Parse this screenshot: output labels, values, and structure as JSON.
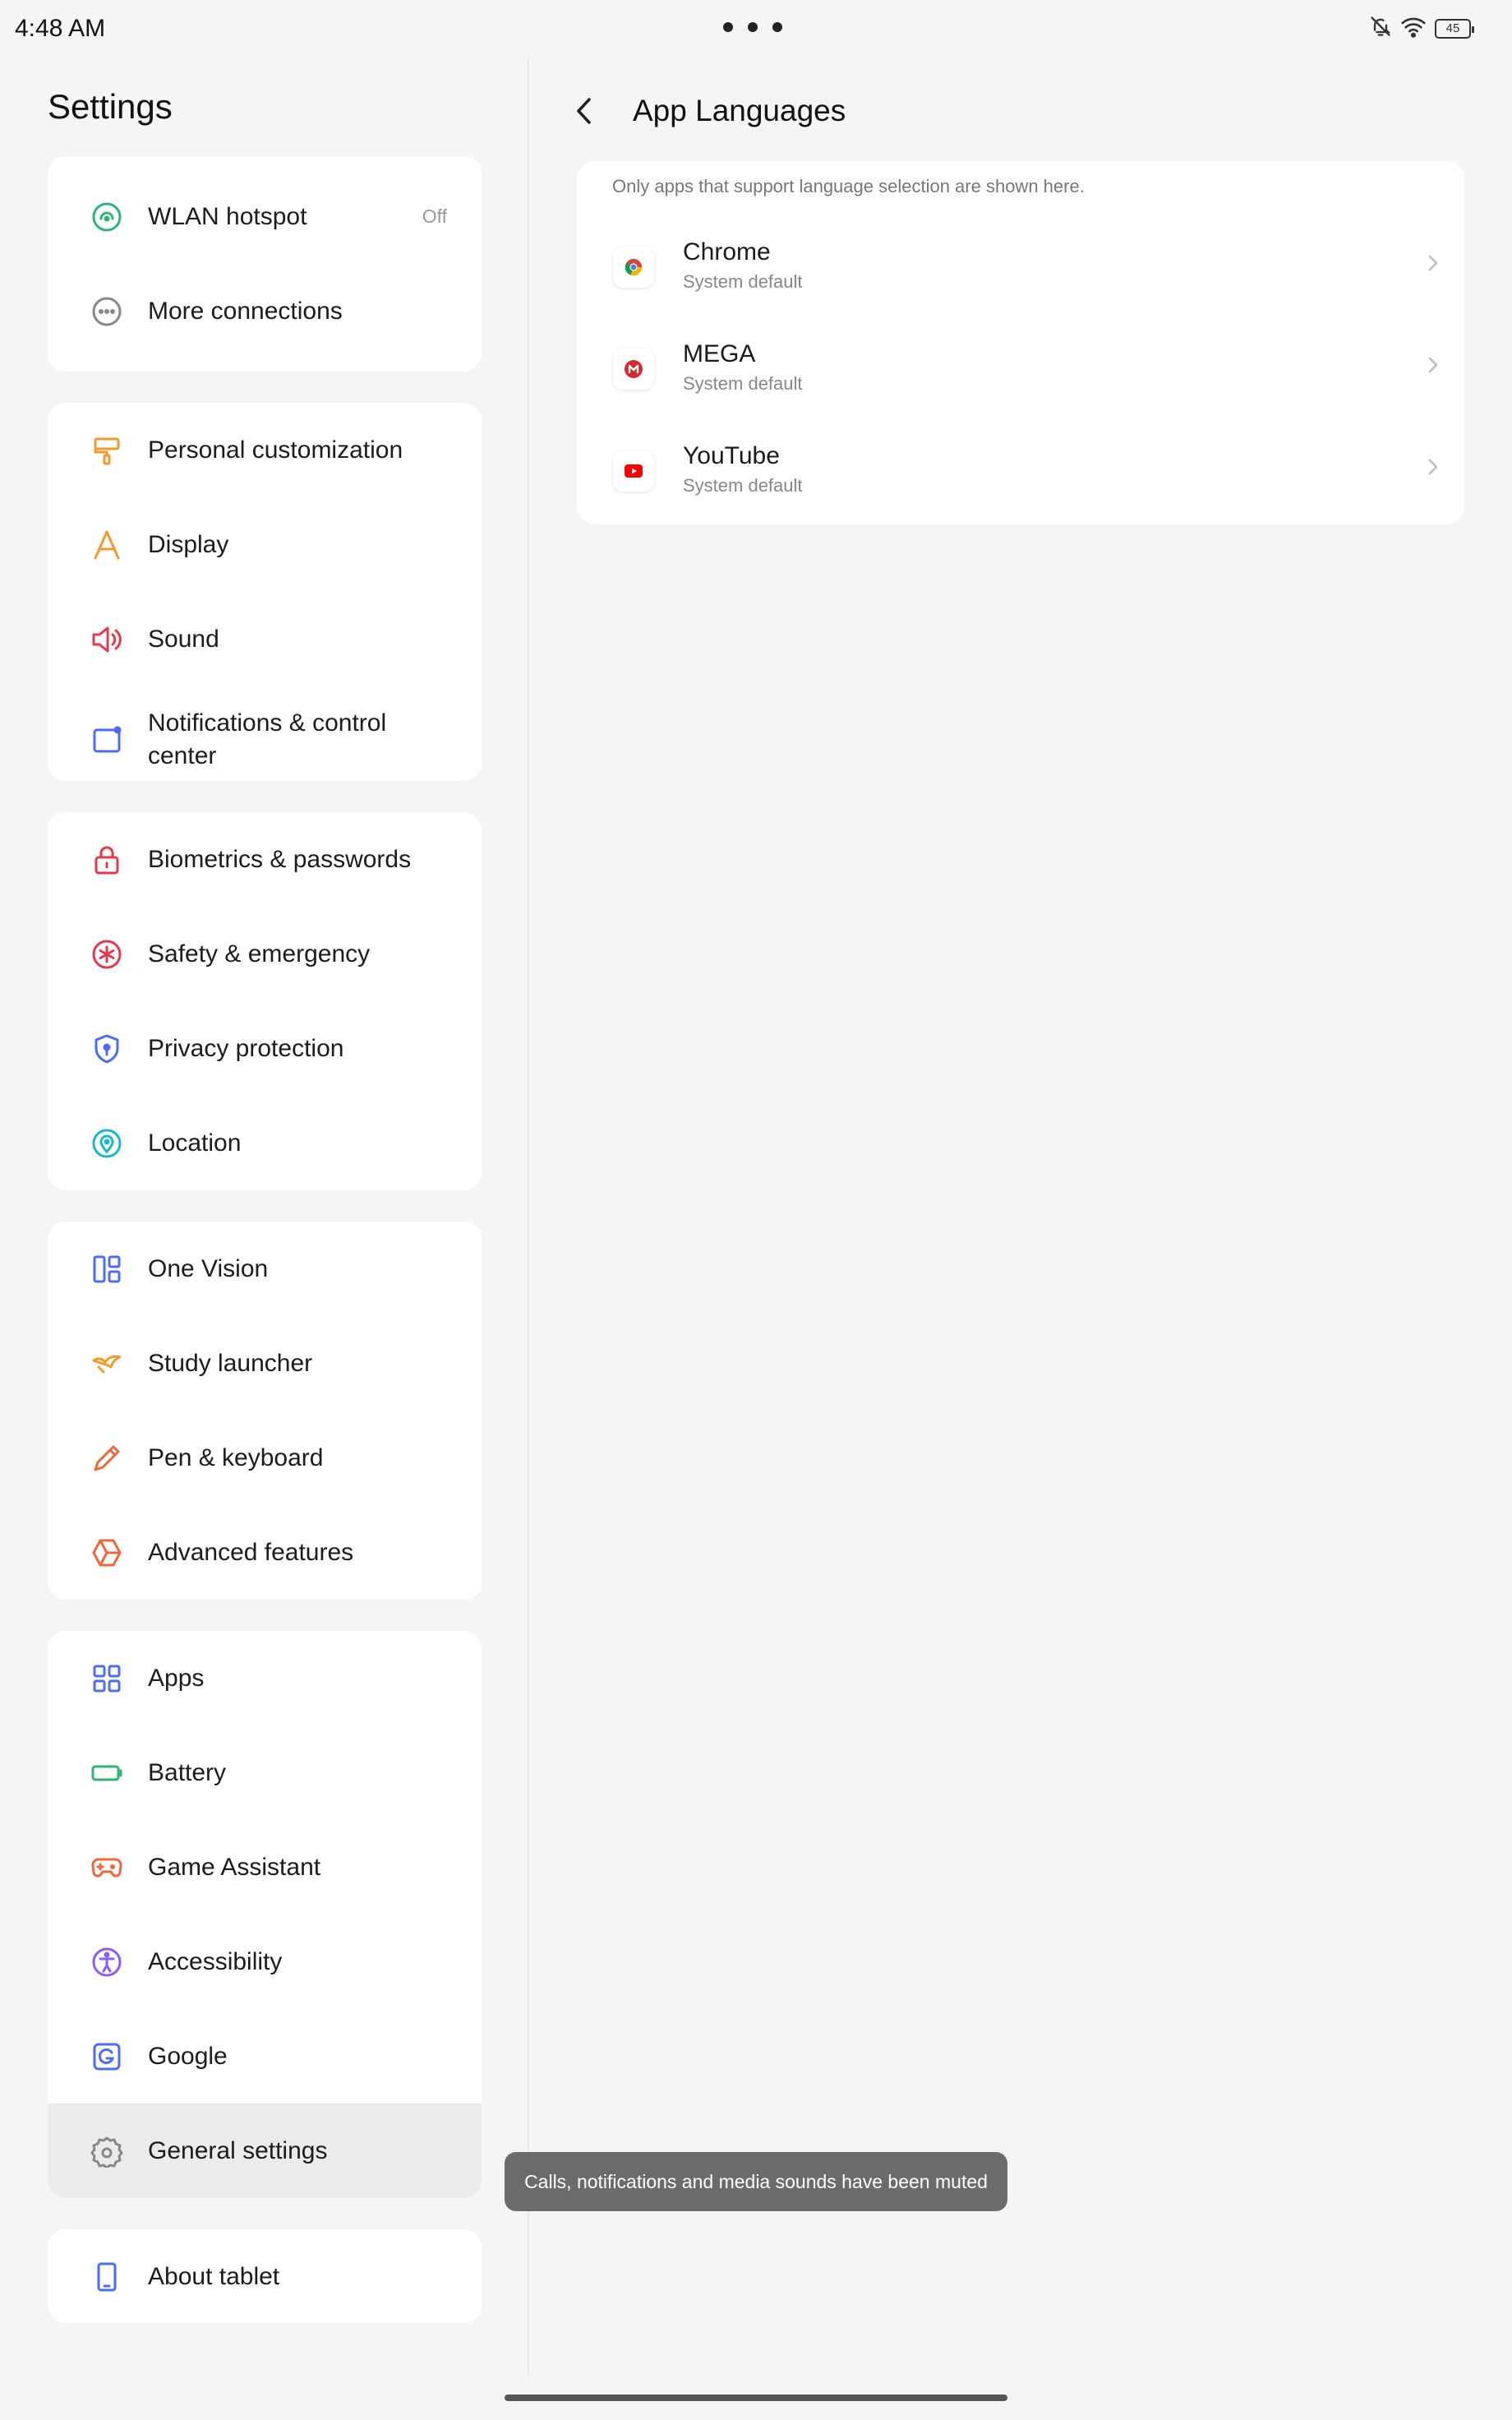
{
  "status_bar": {
    "time": "4:48 AM",
    "battery_level": "45",
    "icons": [
      "mute-bell-icon",
      "wifi-icon",
      "battery-icon"
    ]
  },
  "left": {
    "title": "Settings",
    "groups": [
      [
        {
          "label": "WLAN hotspot",
          "value": "Off",
          "icon": "hotspot-icon"
        },
        {
          "label": "More connections",
          "icon": "more-connections-icon"
        }
      ],
      [
        {
          "label": "Personal customization",
          "icon": "paint-brush-icon"
        },
        {
          "label": "Display",
          "icon": "display-icon"
        },
        {
          "label": "Sound",
          "icon": "speaker-icon"
        },
        {
          "label": "Notifications & control center",
          "icon": "notifications-icon"
        }
      ],
      [
        {
          "label": "Biometrics & passwords",
          "icon": "lock-icon"
        },
        {
          "label": "Safety & emergency",
          "icon": "emergency-icon"
        },
        {
          "label": "Privacy protection",
          "icon": "shield-icon"
        },
        {
          "label": "Location",
          "icon": "location-pin-icon"
        }
      ],
      [
        {
          "label": "One Vision",
          "icon": "layout-icon"
        },
        {
          "label": "Study launcher",
          "icon": "study-icon"
        },
        {
          "label": "Pen & keyboard",
          "icon": "pen-icon"
        },
        {
          "label": "Advanced features",
          "icon": "cube-icon"
        }
      ],
      [
        {
          "label": "Apps",
          "icon": "apps-grid-icon"
        },
        {
          "label": "Battery",
          "icon": "battery-setting-icon"
        },
        {
          "label": "Game Assistant",
          "icon": "gamepad-icon"
        },
        {
          "label": "Accessibility",
          "icon": "accessibility-icon"
        },
        {
          "label": "Google",
          "icon": "google-icon"
        },
        {
          "label": "General settings",
          "icon": "gear-icon",
          "selected": true
        }
      ],
      [
        {
          "label": "About tablet",
          "icon": "tablet-icon"
        }
      ]
    ]
  },
  "right": {
    "title": "App Languages",
    "note": "Only apps that support language selection are shown here.",
    "apps": [
      {
        "name": "Chrome",
        "language": "System default",
        "icon": "chrome-icon"
      },
      {
        "name": "MEGA",
        "language": "System default",
        "icon": "mega-icon"
      },
      {
        "name": "YouTube",
        "language": "System default",
        "icon": "youtube-icon"
      }
    ]
  },
  "toast": "Calls, notifications and media sounds have been muted",
  "colors": {
    "green": "#2bb673",
    "orange": "#f39a2b",
    "red": "#e8374b",
    "blue": "#4a6cf7",
    "purple": "#8b5cf6",
    "cyan": "#1bb8c9",
    "gray": "#888888"
  }
}
